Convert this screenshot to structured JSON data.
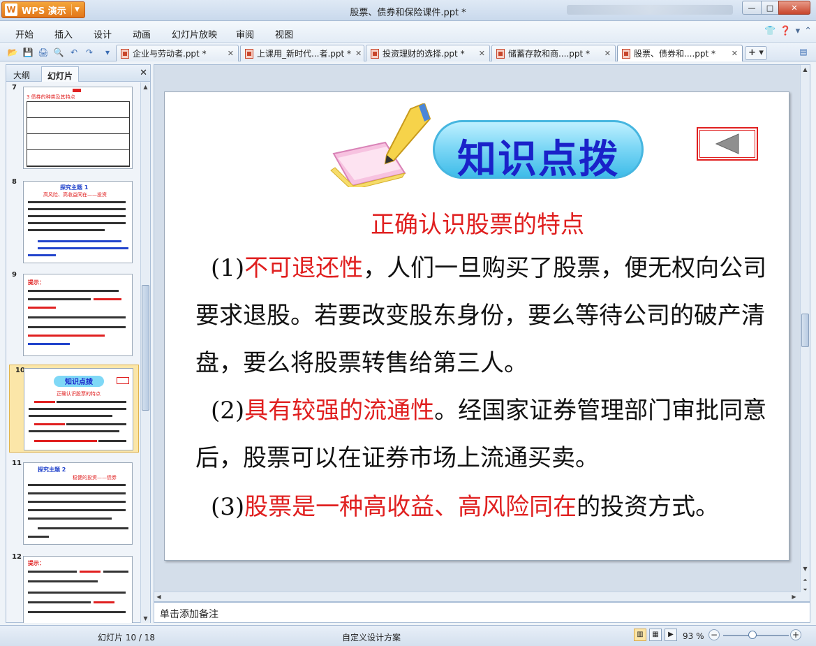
{
  "app": {
    "name": "WPS 演示",
    "window_title": "股票、债券和保险课件.ppt *"
  },
  "menu": [
    "开始",
    "插入",
    "设计",
    "动画",
    "幻灯片放映",
    "审阅",
    "视图"
  ],
  "doc_tabs": [
    {
      "label": "企业与劳动者.ppt *",
      "active": false
    },
    {
      "label": "上课用_新时代...者.ppt *",
      "active": false
    },
    {
      "label": "投资理财的选择.ppt *",
      "active": false
    },
    {
      "label": "储蓄存款和商....ppt *",
      "active": false
    },
    {
      "label": "股票、债券和....ppt *",
      "active": true
    }
  ],
  "left_panel": {
    "tabs": [
      "大纲",
      "幻灯片"
    ],
    "active_tab": "幻灯片",
    "thumbnails": [
      {
        "number": "7",
        "heading": "3 债券的种类及其特点"
      },
      {
        "number": "8",
        "heading": "探究主题 1",
        "subheading": "高风险、高收益同在——投资"
      },
      {
        "number": "9",
        "heading": "提示："
      },
      {
        "number": "10",
        "heading": "知识点拨",
        "subheading": "正确认识股票的特点",
        "selected": true
      },
      {
        "number": "11",
        "heading": "探究主题 2",
        "subheading": "稳健的投资——债券"
      },
      {
        "number": "12",
        "heading": "提示："
      }
    ]
  },
  "slide": {
    "banner_text": "知识点拨",
    "title": "正确认识股票的特点",
    "points": [
      {
        "num": "(1)",
        "highlight": "不可退还性",
        "rest": "，人们一旦购买了股票，便无权向公司要求退股。若要改变股东身份，要么等待公司的破产清盘，要么将股票转售给第三人。"
      },
      {
        "num": "(2)",
        "highlight": "具有较强的流通性",
        "rest": "。经国家证券管理部门审批同意后，股票可以在证券市场上流通买卖。"
      },
      {
        "num": "(3)",
        "highlight": "股票是一种高收益、高风险同在",
        "rest": "的投资方式。"
      }
    ]
  },
  "notes_placeholder": "单击添加备注",
  "status": {
    "slide_info": "幻灯片 10 / 18",
    "design": "自定义设计方案",
    "zoom": "93 %"
  },
  "colors": {
    "highlight_red": "#e02020",
    "banner_blue": "#1a22c9",
    "wps_orange": "#e2761a"
  }
}
